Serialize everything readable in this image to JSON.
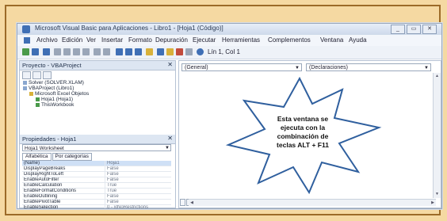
{
  "window": {
    "title": "Microsoft Visual Basic para Aplicaciones - Libro1 - [Hoja1 (Código)]",
    "buttons": [
      "_",
      "▭",
      "✕"
    ]
  },
  "menu": [
    "Archivo",
    "Edición",
    "Ver",
    "Insertar",
    "Formato",
    "Depuración",
    "Ejecutar",
    "Herramientas",
    "Complementos",
    "Ventana",
    "Ayuda"
  ],
  "toolbar": {
    "position": "Lín 1, Col 1"
  },
  "project_pane": {
    "title": "Proyecto - VBAProject",
    "tree": [
      "Solver (SOLVER.XLAM)",
      "VBAProject (Libro1)",
      "Microsoft Excel Objetos",
      "Hoja1 (Hoja1)",
      "ThisWorkbook"
    ]
  },
  "properties_pane": {
    "title": "Propiedades - Hoja1",
    "object": "Hoja1 Worksheet",
    "tabs": [
      "Alfabética",
      "Por categorías"
    ],
    "rows": [
      [
        "(Name)",
        "Hoja1"
      ],
      [
        "DisplayPageBreaks",
        "False"
      ],
      [
        "DisplayRightToLeft",
        "False"
      ],
      [
        "EnableAutoFilter",
        "False"
      ],
      [
        "EnableCalculation",
        "True"
      ],
      [
        "EnableFormatConditions",
        "True"
      ],
      [
        "EnableOutlining",
        "False"
      ],
      [
        "EnablePivotTable",
        "False"
      ],
      [
        "EnableSelection",
        "0 - xlNoRestrictions"
      ],
      [
        "Name",
        "Hoja1"
      ],
      [
        "ScrollArea",
        ""
      ]
    ]
  },
  "code_pane": {
    "object_dropdown": "(General)",
    "proc_dropdown": "(Declaraciones)"
  },
  "callout": {
    "lines": [
      "Esta ventana se",
      "ejecuta con la",
      "combinación de",
      "teclas ALT + F11"
    ]
  }
}
